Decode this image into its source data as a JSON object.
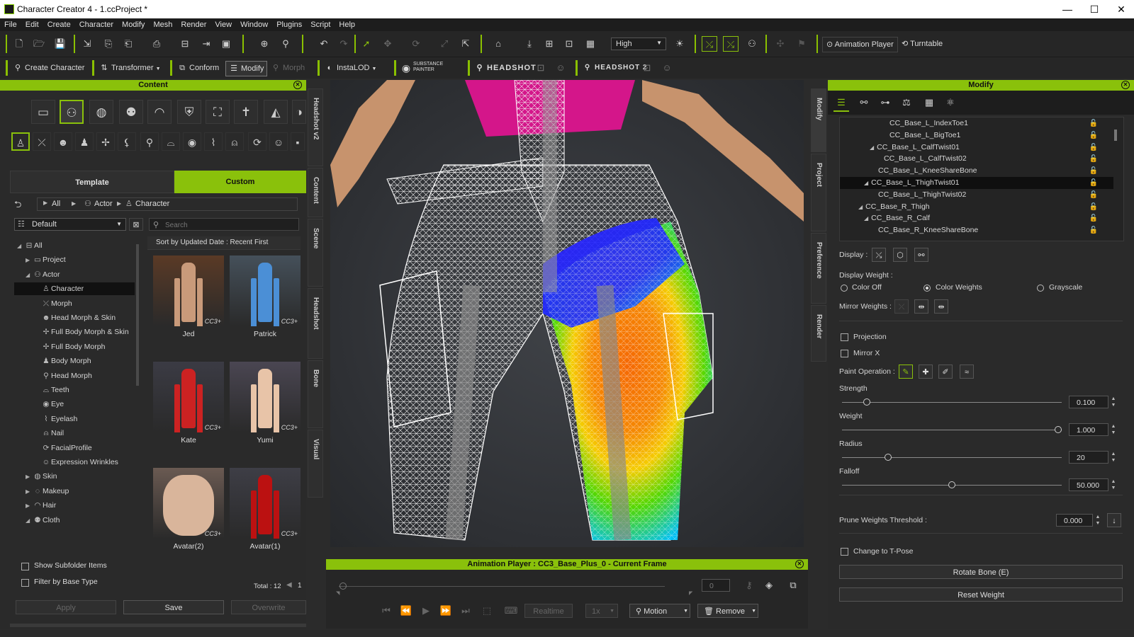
{
  "window": {
    "title": "Character Creator 4 - 1.ccProject *",
    "controls": [
      "—",
      "☐",
      "✕"
    ]
  },
  "menu": [
    "File",
    "Edit",
    "Create",
    "Character",
    "Modify",
    "Mesh",
    "Render",
    "View",
    "Window",
    "Plugins",
    "Script",
    "Help"
  ],
  "toolbar1": {
    "quality": "High",
    "animation_player": "Animation Player",
    "turntable": "Turntable"
  },
  "toolbar2": {
    "create_character": "Create Character",
    "transformer": "Transformer",
    "conform": "Conform",
    "modify": "Modify",
    "morph": "Morph",
    "instalod": "InstaLOD",
    "substance_painter": "SUBSTANCE PAINTER",
    "headshot": "HEADSHOT",
    "headshot2": "HEADSHOT 2"
  },
  "content_panel": {
    "title": "Content",
    "tabs": {
      "template": "Template",
      "custom": "Custom"
    },
    "breadcrumb": [
      "All",
      "Actor",
      "Character"
    ],
    "filter_preset": "Default",
    "search_placeholder": "Search",
    "sort_label": "Sort by Updated Date : Recent First",
    "tree": [
      {
        "label": "All",
        "level": 0,
        "arrow": "◢"
      },
      {
        "label": "Project",
        "level": 1,
        "arrow": "▶"
      },
      {
        "label": "Actor",
        "level": 1,
        "arrow": "◢"
      },
      {
        "label": "Character",
        "level": 2,
        "arrow": "",
        "selected": true
      },
      {
        "label": "Morph",
        "level": 2,
        "arrow": ""
      },
      {
        "label": "Head Morph & Skin",
        "level": 2,
        "arrow": ""
      },
      {
        "label": "Full Body Morph & Skin",
        "level": 2,
        "arrow": ""
      },
      {
        "label": "Full Body Morph",
        "level": 2,
        "arrow": ""
      },
      {
        "label": "Body Morph",
        "level": 2,
        "arrow": ""
      },
      {
        "label": "Head Morph",
        "level": 2,
        "arrow": ""
      },
      {
        "label": "Teeth",
        "level": 2,
        "arrow": ""
      },
      {
        "label": "Eye",
        "level": 2,
        "arrow": ""
      },
      {
        "label": "Eyelash",
        "level": 2,
        "arrow": ""
      },
      {
        "label": "Nail",
        "level": 2,
        "arrow": ""
      },
      {
        "label": "FacialProfile",
        "level": 2,
        "arrow": ""
      },
      {
        "label": "Expression Wrinkles",
        "level": 2,
        "arrow": ""
      },
      {
        "label": "Skin",
        "level": 1,
        "arrow": "▶"
      },
      {
        "label": "Makeup",
        "level": 1,
        "arrow": "▶"
      },
      {
        "label": "Hair",
        "level": 1,
        "arrow": "▶"
      },
      {
        "label": "Cloth",
        "level": 1,
        "arrow": "◢"
      }
    ],
    "thumbnails": [
      {
        "name": "Jed",
        "badge": "CC3+"
      },
      {
        "name": "Patrick",
        "badge": "CC3+"
      },
      {
        "name": "Kate",
        "badge": "CC3+"
      },
      {
        "name": "Yumi",
        "badge": "CC3+"
      },
      {
        "name": "Avatar(2)",
        "badge": "CC3+"
      },
      {
        "name": "Avatar(1)",
        "badge": "CC3+"
      }
    ],
    "show_subfolder": "Show Subfolder Items",
    "filter_base_type": "Filter by Base Type",
    "total": "Total : 12",
    "page": "1",
    "apply": "Apply",
    "save": "Save",
    "overwrite": "Overwrite"
  },
  "side_tabs_left": [
    "Headshot v2",
    "Content",
    "Scene",
    "Headshot",
    "Bone",
    "Visual"
  ],
  "side_tabs_right": [
    "Modify",
    "Project",
    "Preference",
    "Render"
  ],
  "modify_panel": {
    "title": "Modify",
    "bones": [
      {
        "label": "CC_Base_L_IndexToe1",
        "indent": 66,
        "arrow": ""
      },
      {
        "label": "CC_Base_L_BigToe1",
        "indent": 66,
        "arrow": ""
      },
      {
        "label": "CC_Base_L_CalfTwist01",
        "indent": 42,
        "arrow": "◢"
      },
      {
        "label": "CC_Base_L_CalfTwist02",
        "indent": 58,
        "arrow": ""
      },
      {
        "label": "CC_Base_L_KneeShareBone",
        "indent": 50,
        "arrow": ""
      },
      {
        "label": "CC_Base_L_ThighTwist01",
        "indent": 34,
        "arrow": "◢",
        "selected": true
      },
      {
        "label": "CC_Base_L_ThighTwist02",
        "indent": 50,
        "arrow": ""
      },
      {
        "label": "CC_Base_R_Thigh",
        "indent": 26,
        "arrow": "◢"
      },
      {
        "label": "CC_Base_R_Calf",
        "indent": 34,
        "arrow": "◢"
      },
      {
        "label": "CC_Base_R_KneeShareBone",
        "indent": 50,
        "arrow": ""
      }
    ],
    "display_label": "Display :",
    "display_weight_label": "Display Weight :",
    "weight_modes": [
      "Color Off",
      "Color Weights",
      "Grayscale"
    ],
    "weight_mode_selected": "Color Weights",
    "mirror_weights_label": "Mirror Weights :",
    "projection": "Projection",
    "mirror_x": "Mirror X",
    "paint_operation_label": "Paint Operation :",
    "sliders": [
      {
        "label": "Strength",
        "value": "0.100",
        "fraction": 0.1
      },
      {
        "label": "Weight",
        "value": "1.000",
        "fraction": 1.0
      },
      {
        "label": "Radius",
        "value": "20",
        "fraction": 0.2
      },
      {
        "label": "Falloff",
        "value": "50.000",
        "fraction": 0.5
      }
    ],
    "prune_label": "Prune Weights Threshold :",
    "prune_value": "0.000",
    "change_tpose": "Change to T-Pose",
    "rotate_bone": "Rotate Bone (E)",
    "reset_weight": "Reset Weight"
  },
  "animation_player": {
    "title": "Animation Player : CC3_Base_Plus_0 - Current Frame",
    "frame": "0",
    "realtime": "Realtime",
    "speed": "1x",
    "motion": "Motion",
    "remove": "Remove"
  }
}
